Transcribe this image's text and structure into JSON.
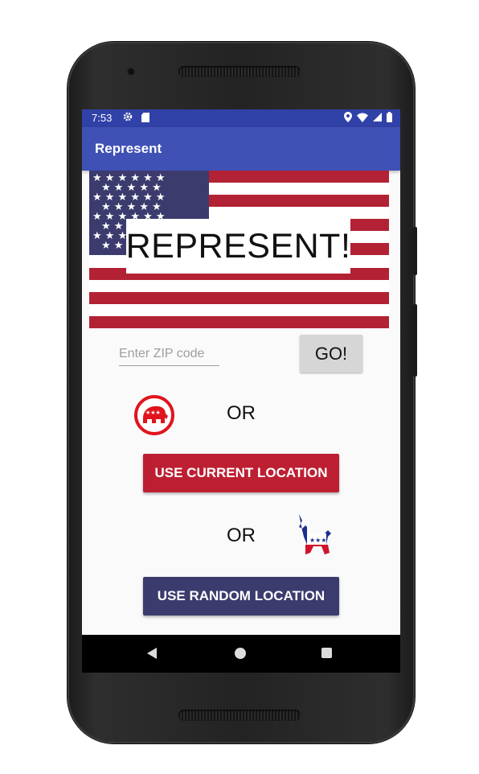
{
  "status_bar": {
    "time": "7:53",
    "icons": [
      "gear-icon",
      "sd-card-icon",
      "location-icon",
      "wifi-icon",
      "signal-icon",
      "battery-icon"
    ]
  },
  "app_bar": {
    "title": "Represent"
  },
  "banner": {
    "title": "REPRESENT!"
  },
  "zip": {
    "placeholder": "Enter ZIP code",
    "value": ""
  },
  "go_button": {
    "label": "GO!"
  },
  "or_label": "OR",
  "current_location_button": {
    "label": "USE CURRENT LOCATION"
  },
  "random_location_button": {
    "label": "USE RANDOM LOCATION"
  },
  "nav": {
    "icons": [
      "back-icon",
      "home-icon",
      "recents-icon"
    ]
  },
  "colors": {
    "app_bar": "#3f51b5",
    "status_bar": "#3041a8",
    "republican_red": "#bd1f32",
    "democrat_navy": "#3b3b6e",
    "flag_red": "#b22234",
    "flag_blue": "#3c3b6e"
  }
}
